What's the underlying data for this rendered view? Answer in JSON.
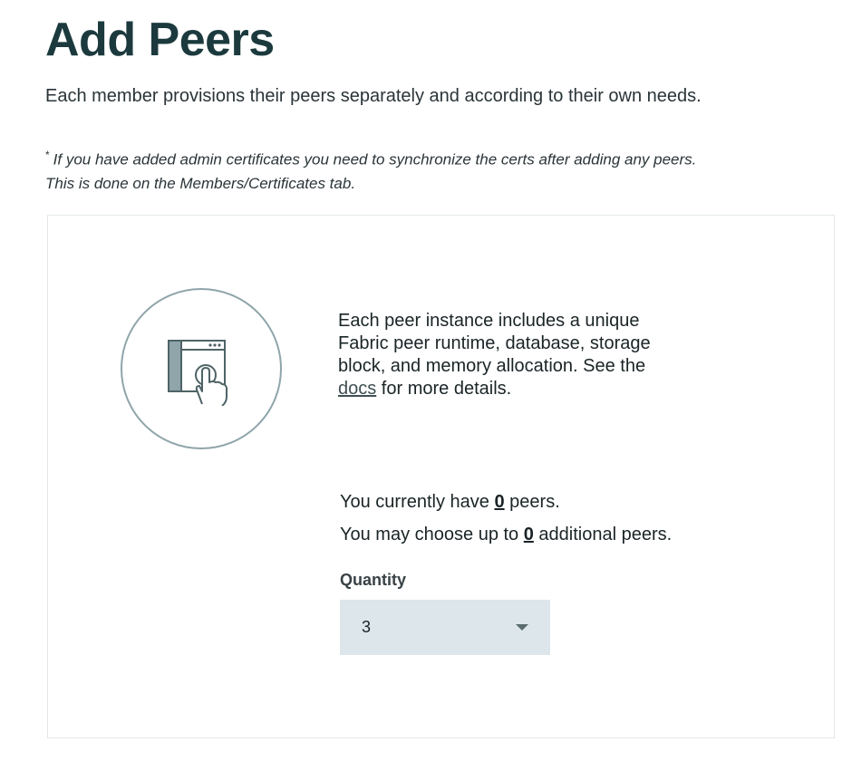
{
  "header": {
    "title": "Add Peers",
    "subtitle": "Each member provisions their peers separately and according to their own needs."
  },
  "note": {
    "marker": "*",
    "line1": "If you have added admin certificates you need to synchronize the certs after adding any peers.",
    "line2": "This is done on the Members/Certificates tab."
  },
  "card": {
    "icon": "touch-screen-icon",
    "info": {
      "line1": "Each peer instance includes a unique",
      "line2": "Fabric peer runtime, database, storage",
      "line3": "block, and memory allocation. See the",
      "link_text": "docs",
      "line4_rest": " for more details."
    },
    "status": {
      "current_prefix": "You currently have ",
      "current_count": "0",
      "current_suffix": " peers.",
      "limit_prefix": "You may choose up to ",
      "limit_count": "0",
      "limit_suffix": " additional peers."
    },
    "quantity": {
      "label": "Quantity",
      "selected": "3"
    }
  }
}
